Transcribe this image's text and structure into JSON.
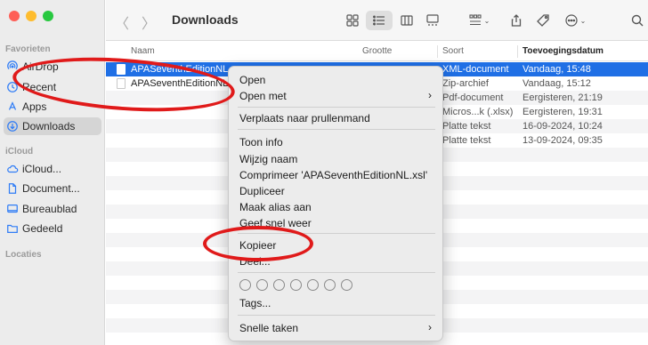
{
  "toolbar": {
    "title": "Downloads",
    "back_icon": "chevron-left-icon",
    "forward_icon": "chevron-right-icon"
  },
  "sidebar": {
    "favorites_title": "Favorieten",
    "icloud_title": "iCloud",
    "locations_title": "Locaties",
    "items": [
      {
        "label": "AirDrop",
        "icon": "airdrop-icon"
      },
      {
        "label": "Recent",
        "icon": "clock-icon"
      },
      {
        "label": "Apps",
        "icon": "apps-icon"
      },
      {
        "label": "Downloads",
        "icon": "download-icon"
      },
      {
        "label": "iCloud...",
        "icon": "cloud-icon"
      },
      {
        "label": "Document...",
        "icon": "document-icon"
      },
      {
        "label": "Bureaublad",
        "icon": "desktop-icon"
      },
      {
        "label": "Gedeeld",
        "icon": "shared-folder-icon"
      }
    ]
  },
  "columns": {
    "name": "Naam",
    "size": "Grootte",
    "kind": "Soort",
    "date_added": "Toevoegingsdatum"
  },
  "rows": [
    {
      "name": "APASeventhEditionNL",
      "kind": "XML-document",
      "date": "Vandaag, 15:48"
    },
    {
      "name": "APASeventhEditionNL",
      "kind": "Zip-archief",
      "date": "Vandaag, 15:12"
    },
    {
      "name": "",
      "kind": "Pdf-document",
      "date": "Eergisteren, 21:19"
    },
    {
      "name": "",
      "kind": "Micros...k (.xlsx)",
      "date": "Eergisteren, 19:31"
    },
    {
      "name": "",
      "kind": "Platte tekst",
      "date": "16-09-2024, 10:24"
    },
    {
      "name": "",
      "kind": "Platte tekst",
      "date": "13-09-2024, 09:35"
    }
  ],
  "context_menu": {
    "open": "Open",
    "open_with": "Open met",
    "move_to_trash": "Verplaats naar prullenmand",
    "get_info": "Toon info",
    "rename": "Wijzig naam",
    "compress": "Comprimeer 'APASeventhEditionNL.xsl'",
    "duplicate": "Dupliceer",
    "make_alias": "Maak alias aan",
    "quick_look": "Geef snel weer",
    "copy": "Kopieer",
    "share": "Deel...",
    "tags": "Tags...",
    "quick_actions": "Snelle taken",
    "submenu_arrow": "›"
  },
  "colors": {
    "selection": "#1f6fe5",
    "annotation": "#e01a1a",
    "accent": "#2f7cf6"
  }
}
